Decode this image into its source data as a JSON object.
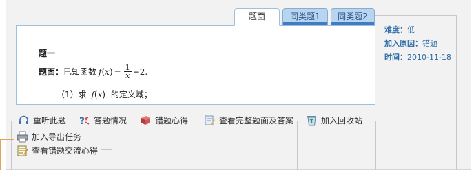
{
  "tabs": [
    {
      "label": "题面",
      "active": true
    },
    {
      "label": "同类题1",
      "active": false
    },
    {
      "label": "同类题2",
      "active": false
    }
  ],
  "question": {
    "title": "题一",
    "stem_label": "题面：",
    "stem_text": "已知函数",
    "func": "f",
    "var": "x",
    "frac_num": "1",
    "frac_den": "x",
    "tail": "−2.",
    "sub_prefix": "（1）求",
    "sub_suffix": "的定义域；"
  },
  "info": {
    "difficulty_label": "难度：",
    "difficulty_value": "低",
    "reason_label": "加入原因：",
    "reason_value": "错题",
    "time_label": "时间：",
    "time_value": "2010-11-18"
  },
  "toolbar": {
    "listen": "重听此题",
    "answer_status": "答题情况",
    "mistake_notes": "错题心得",
    "view_full": "查看完整题面及答案",
    "recycle": "加入回收站",
    "export": "加入导出任务",
    "exchange": "查看错题交流心得"
  },
  "colors": {
    "accent": "#2b6aa8",
    "tab_blue": "#b9d4ee",
    "tab_bar": "#3e7dc4",
    "border": "#9ec0dd",
    "panel": "#f2f2f2"
  }
}
